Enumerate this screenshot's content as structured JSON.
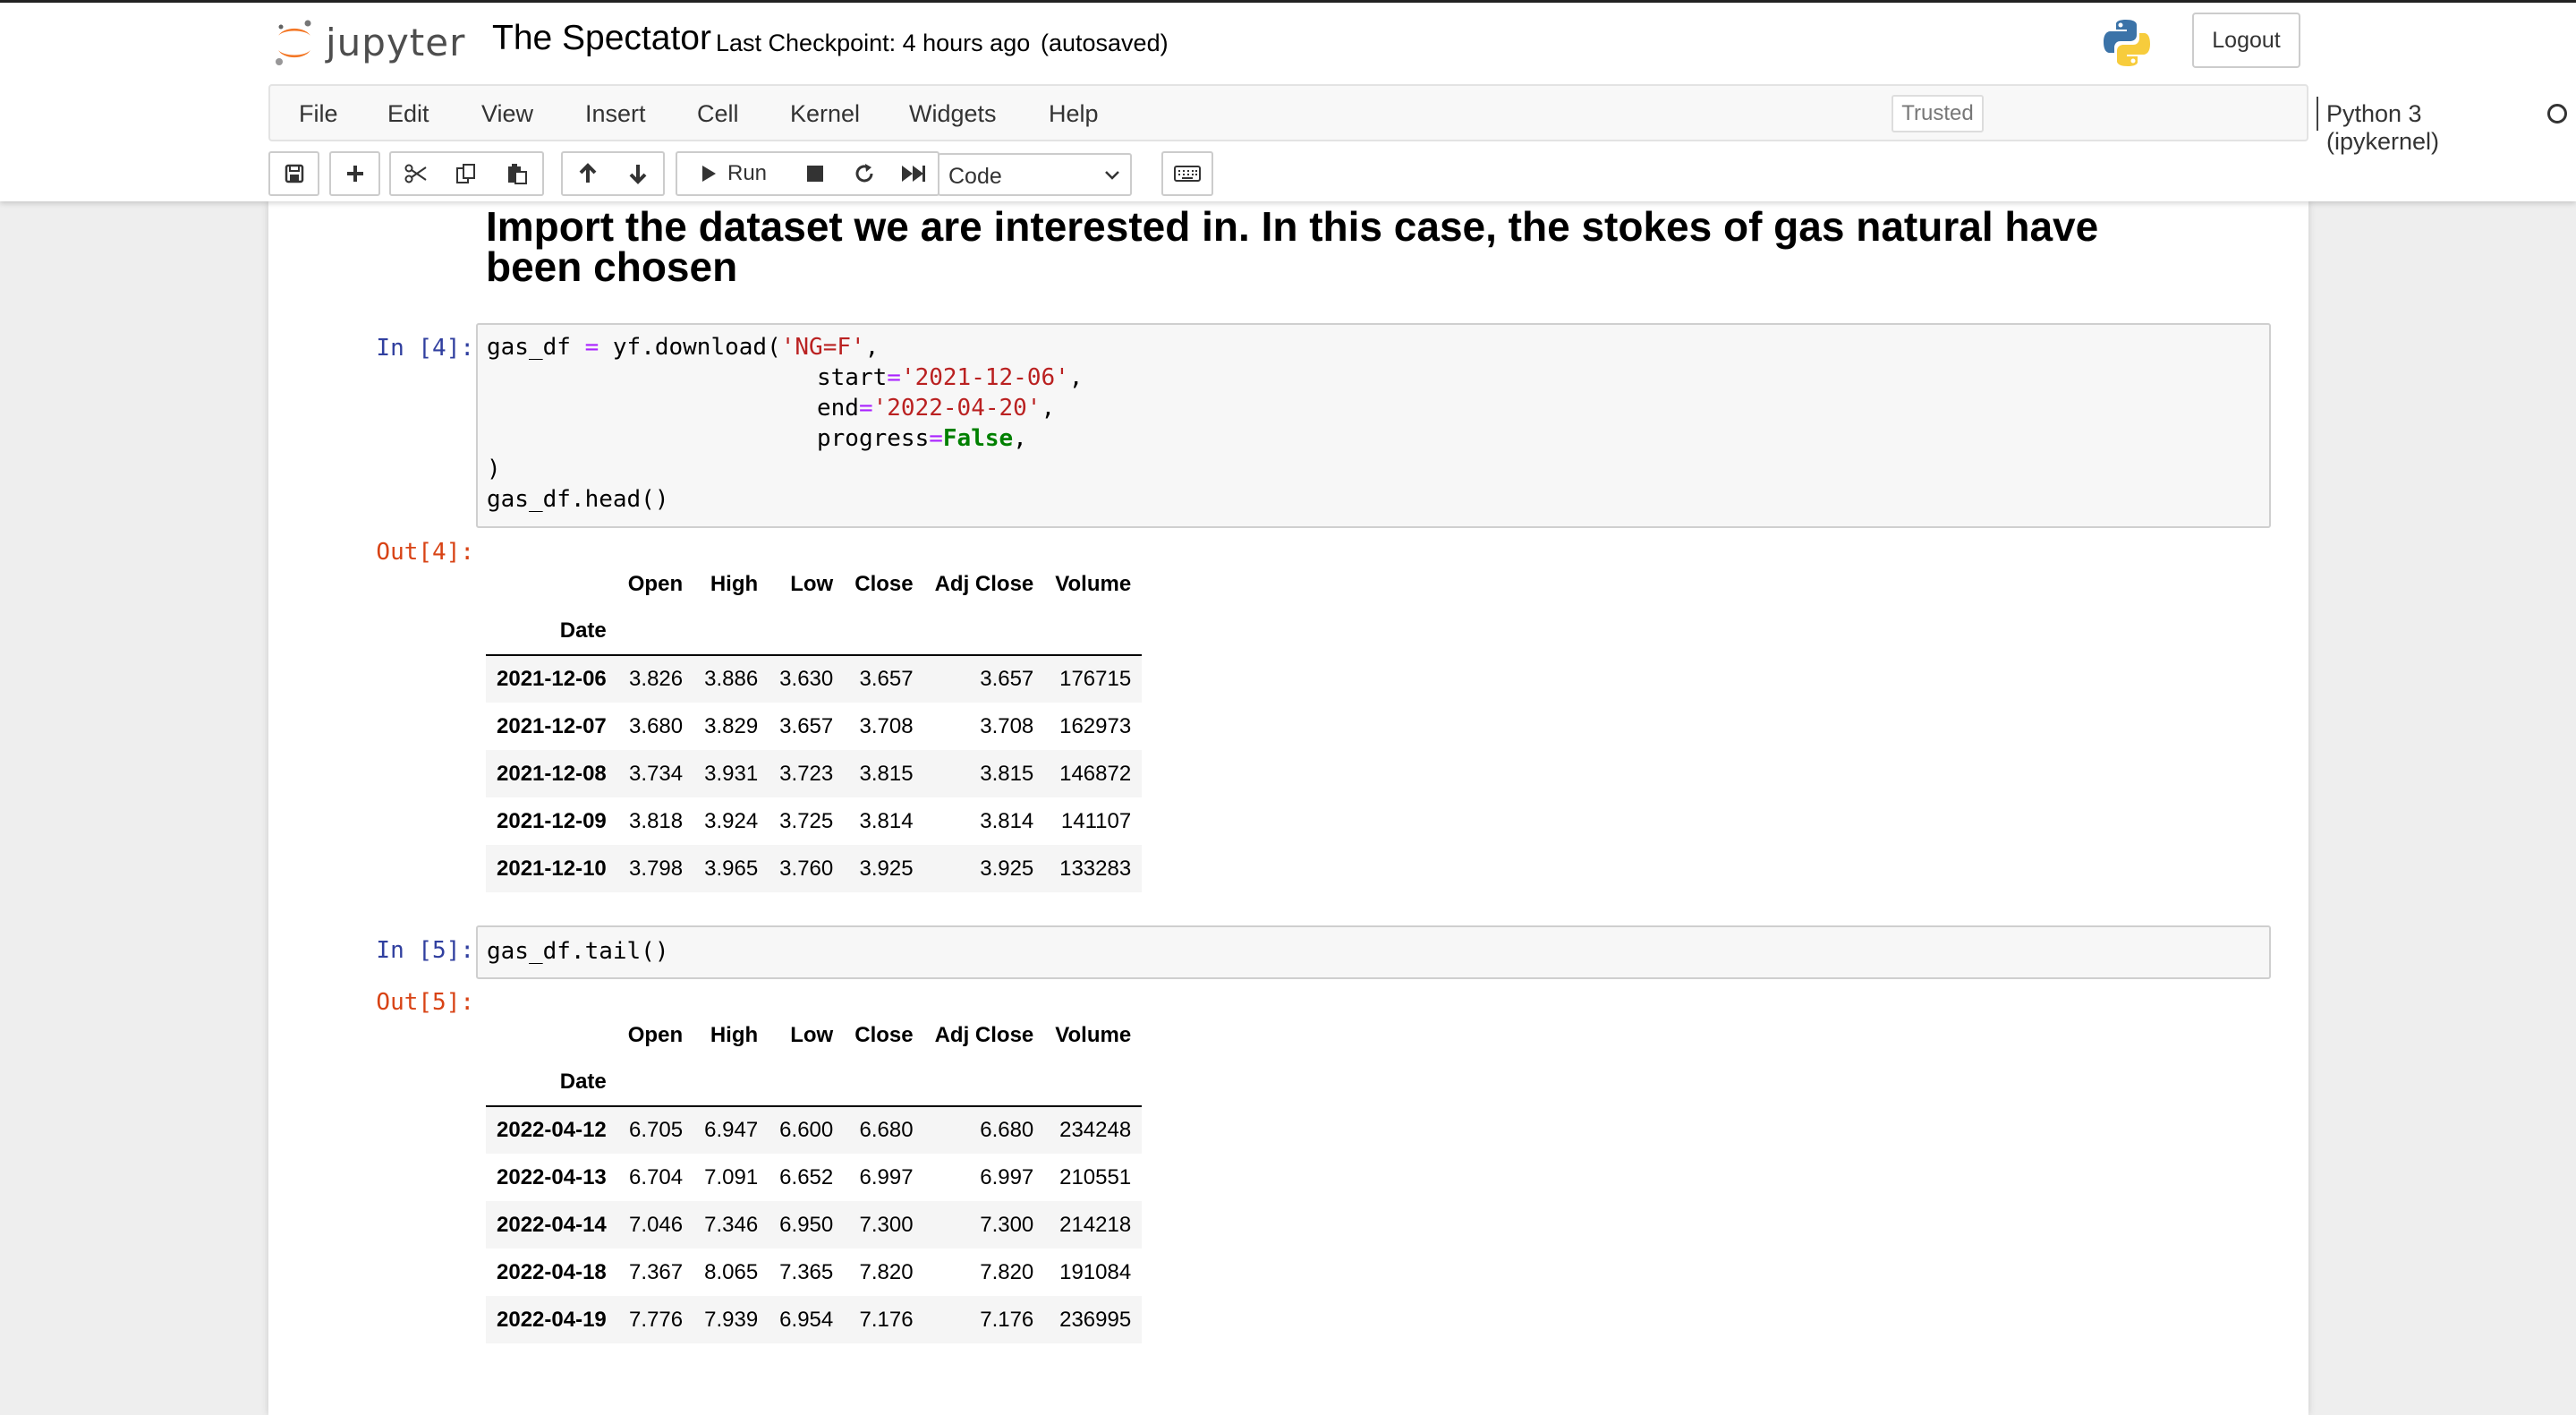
{
  "header": {
    "logo_text": "jupyter",
    "notebook_name": "The Spectator",
    "checkpoint_text": "Last Checkpoint: 4 hours ago",
    "autosave_text": "(autosaved)",
    "logout_label": "Logout"
  },
  "menubar": {
    "items": [
      "File",
      "Edit",
      "View",
      "Insert",
      "Cell",
      "Kernel",
      "Widgets",
      "Help"
    ],
    "trusted_label": "Trusted",
    "kernel_name": "Python 3 (ipykernel)"
  },
  "toolbar": {
    "run_label": "Run",
    "cell_type": "Code"
  },
  "notebook": {
    "markdown_heading": "Import the dataset we are interested in. In this case, the stokes of gas natural have been chosen",
    "cell4": {
      "in_prompt": "In [4]:",
      "out_prompt": "Out[4]:",
      "code": {
        "l1_var": "gas_df",
        "l1_eq": "=",
        "l1_call": "yf.download(",
        "l1_arg": "'NG=F'",
        "l1_comma": ",",
        "l2_kw": "start",
        "l2_eq": "=",
        "l2_val": "'2021-12-06'",
        "l2_comma": ",",
        "l3_kw": "end",
        "l3_eq": "=",
        "l3_val": "'2022-04-20'",
        "l3_comma": ",",
        "l4_kw": "progress",
        "l4_eq": "=",
        "l4_val": "False",
        "l4_comma": ",",
        "l5": ")",
        "l6": "gas_df.head()"
      },
      "table": {
        "columns": [
          "Open",
          "High",
          "Low",
          "Close",
          "Adj Close",
          "Volume"
        ],
        "index_name": "Date",
        "rows": [
          {
            "date": "2021-12-06",
            "values": [
              "3.826",
              "3.886",
              "3.630",
              "3.657",
              "3.657",
              "176715"
            ]
          },
          {
            "date": "2021-12-07",
            "values": [
              "3.680",
              "3.829",
              "3.657",
              "3.708",
              "3.708",
              "162973"
            ]
          },
          {
            "date": "2021-12-08",
            "values": [
              "3.734",
              "3.931",
              "3.723",
              "3.815",
              "3.815",
              "146872"
            ]
          },
          {
            "date": "2021-12-09",
            "values": [
              "3.818",
              "3.924",
              "3.725",
              "3.814",
              "3.814",
              "141107"
            ]
          },
          {
            "date": "2021-12-10",
            "values": [
              "3.798",
              "3.965",
              "3.760",
              "3.925",
              "3.925",
              "133283"
            ]
          }
        ]
      }
    },
    "cell5": {
      "in_prompt": "In [5]:",
      "out_prompt": "Out[5]:",
      "code_line": "gas_df.tail()",
      "table": {
        "columns": [
          "Open",
          "High",
          "Low",
          "Close",
          "Adj Close",
          "Volume"
        ],
        "index_name": "Date",
        "rows": [
          {
            "date": "2022-04-12",
            "values": [
              "6.705",
              "6.947",
              "6.600",
              "6.680",
              "6.680",
              "234248"
            ]
          },
          {
            "date": "2022-04-13",
            "values": [
              "6.704",
              "7.091",
              "6.652",
              "6.997",
              "6.997",
              "210551"
            ]
          },
          {
            "date": "2022-04-14",
            "values": [
              "7.046",
              "7.346",
              "6.950",
              "7.300",
              "7.300",
              "214218"
            ]
          },
          {
            "date": "2022-04-18",
            "values": [
              "7.367",
              "8.065",
              "7.365",
              "7.820",
              "7.820",
              "191084"
            ]
          },
          {
            "date": "2022-04-19",
            "values": [
              "7.776",
              "7.939",
              "6.954",
              "7.176",
              "7.176",
              "236995"
            ]
          }
        ]
      }
    }
  }
}
